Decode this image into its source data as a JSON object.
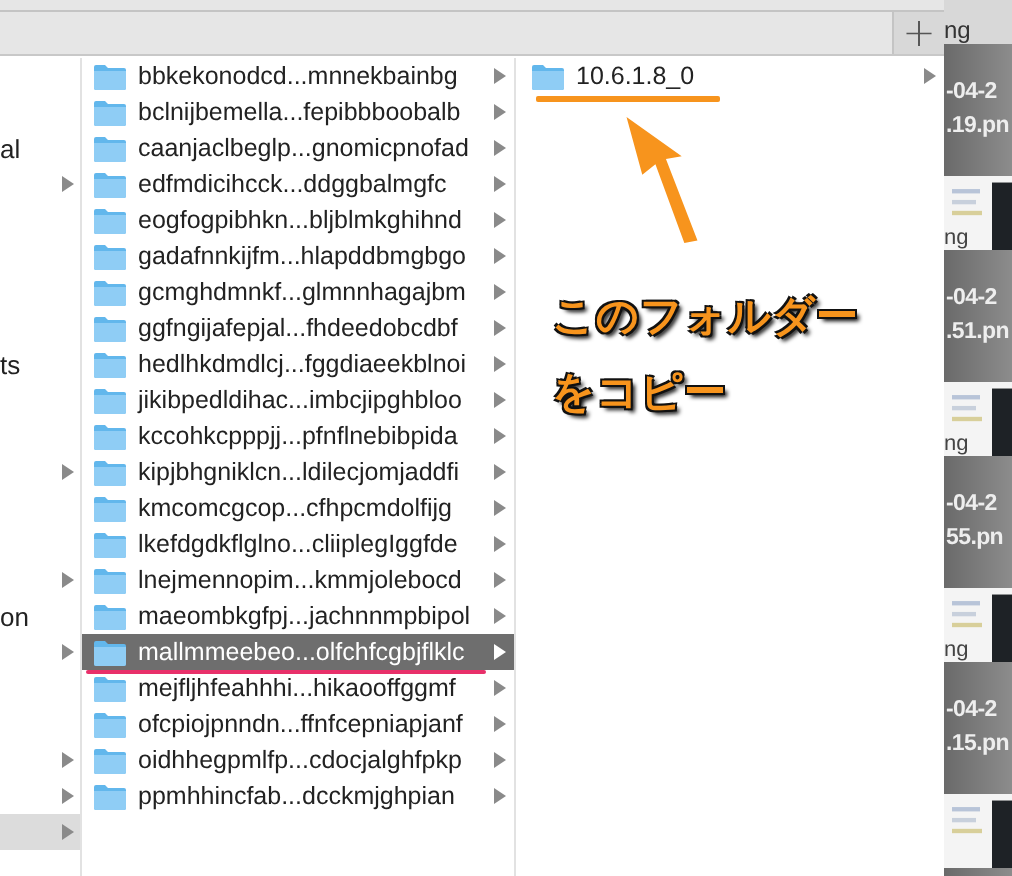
{
  "toolbar": {
    "add_button": "+"
  },
  "sidebar": {
    "rows": [
      {
        "kind": "blank"
      },
      {
        "kind": "blank"
      },
      {
        "kind": "item",
        "label": "al",
        "expandable": false,
        "selected": false
      },
      {
        "kind": "item",
        "expandable": true,
        "selected": false
      },
      {
        "kind": "blank"
      },
      {
        "kind": "blank"
      },
      {
        "kind": "blank"
      },
      {
        "kind": "blank"
      },
      {
        "kind": "item",
        "label": "ts",
        "expandable": false,
        "selected": false
      },
      {
        "kind": "blank"
      },
      {
        "kind": "blank"
      },
      {
        "kind": "item",
        "expandable": true,
        "selected": false
      },
      {
        "kind": "blank"
      },
      {
        "kind": "blank"
      },
      {
        "kind": "item",
        "expandable": true,
        "selected": false
      },
      {
        "kind": "item",
        "label": "on",
        "expandable": false,
        "selected": false
      },
      {
        "kind": "item",
        "expandable": true,
        "selected": false
      },
      {
        "kind": "blank"
      },
      {
        "kind": "blank"
      },
      {
        "kind": "item",
        "expandable": true,
        "selected": false
      },
      {
        "kind": "item",
        "expandable": true,
        "selected": false
      },
      {
        "kind": "item",
        "expandable": true,
        "selected": true
      }
    ]
  },
  "folder_list": {
    "items": [
      {
        "name": "bbkekonodcd...mnnekbainbg",
        "selected": false
      },
      {
        "name": "bclnijbemella...fepibbboobalb",
        "selected": false
      },
      {
        "name": "caanjaclbeglp...gnomicpnofad",
        "selected": false
      },
      {
        "name": "edfmdicihcck...ddggbalmgfc",
        "selected": false
      },
      {
        "name": "eogfogpibhkn...bljblmkghihnd",
        "selected": false
      },
      {
        "name": "gadafnnkijfm...hlapddbmgbgo",
        "selected": false
      },
      {
        "name": "gcmghdmnkf...glmnnhagajbm",
        "selected": false
      },
      {
        "name": "ggfngijafepjal...fhdeedobcdbf",
        "selected": false
      },
      {
        "name": "hedlhkdmdlcj...fggdiaeekblnoi",
        "selected": false
      },
      {
        "name": "jikibpedldihac...imbcjipghbloo",
        "selected": false
      },
      {
        "name": "kccohkcpppjj...pfnflnebibpida",
        "selected": false
      },
      {
        "name": "kipjbhgniklcn...ldilecjomjaddfi",
        "selected": false
      },
      {
        "name": "kmcomcgcop...cfhpcmdolfijg",
        "selected": false
      },
      {
        "name": "lkefdgdkflglno...cliiplegIggfde",
        "selected": false
      },
      {
        "name": "lnejmennopim...kmmjolebocd",
        "selected": false
      },
      {
        "name": "maeombkgfpj...jachnnmpbipol",
        "selected": false
      },
      {
        "name": "mallmmeebeo...olfchfcgbjflklc",
        "selected": true,
        "underlined": true
      },
      {
        "name": "mejfljhfeahhhi...hikaooffggmf",
        "selected": false
      },
      {
        "name": "ofcpiojpnndn...ffnfcepniapjanf",
        "selected": false
      },
      {
        "name": "oidhhegpmlfp...cdocjalghfpkp",
        "selected": false
      },
      {
        "name": "ppmhhincfab...dcckmjghpian",
        "selected": false
      }
    ]
  },
  "subfolder_list": {
    "items": [
      {
        "name": "10.6.1.8_0",
        "selected": false,
        "underlined": true
      }
    ]
  },
  "annotation": {
    "lines": [
      "このフォルダー",
      "をコピー"
    ]
  },
  "desktop": {
    "items": [
      {
        "kind": "caption",
        "text": "ng"
      },
      {
        "kind": "filename",
        "lines": [
          "-04-2",
          ".19.pn"
        ]
      },
      {
        "kind": "thumbnail",
        "text": "ng"
      },
      {
        "kind": "filename",
        "lines": [
          "-04-2",
          ".51.pn"
        ]
      },
      {
        "kind": "thumbnail",
        "text": "ng"
      },
      {
        "kind": "filename",
        "lines": [
          "-04-2",
          "55.pn"
        ]
      },
      {
        "kind": "thumbnail",
        "text": "ng"
      },
      {
        "kind": "filename",
        "lines": [
          "-04-2",
          ".15.pn"
        ]
      },
      {
        "kind": "thumbnail"
      }
    ]
  }
}
